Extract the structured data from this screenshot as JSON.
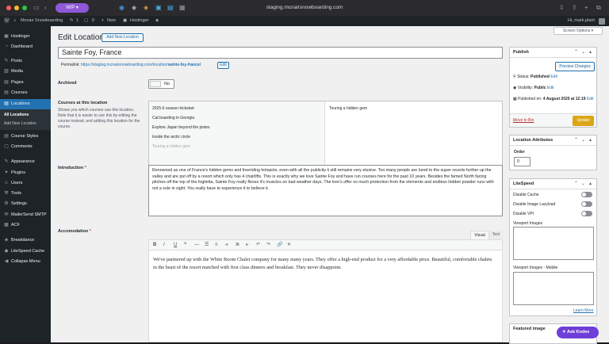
{
  "browser": {
    "wip_label": "WIP",
    "url": "staging.mcnairsnowboarding.com"
  },
  "adminbar": {
    "site": "Mcnair Snowboarding",
    "updates": "1",
    "comments": "0",
    "new": "New",
    "hostinger": "Hostinger",
    "greeting": "Hi, mark.plant"
  },
  "sidebar": {
    "items": [
      {
        "label": "Hostinger",
        "icon": "hostinger-icon"
      },
      {
        "label": "Dashboard",
        "icon": "dashboard-icon"
      },
      {
        "label": "Posts",
        "icon": "pin-icon"
      },
      {
        "label": "Media",
        "icon": "media-icon"
      },
      {
        "label": "Pages",
        "icon": "pages-icon"
      },
      {
        "label": "Courses",
        "icon": "courses-icon"
      },
      {
        "label": "Locations",
        "icon": "location-icon"
      },
      {
        "label": "Course Styles",
        "icon": "styles-icon"
      },
      {
        "label": "Comments",
        "icon": "comment-icon"
      },
      {
        "label": "Appearance",
        "icon": "brush-icon"
      },
      {
        "label": "Plugins",
        "icon": "plugin-icon"
      },
      {
        "label": "Users",
        "icon": "users-icon"
      },
      {
        "label": "Tools",
        "icon": "wrench-icon"
      },
      {
        "label": "Settings",
        "icon": "settings-icon"
      },
      {
        "label": "MailerSend SMTP",
        "icon": "mail-icon"
      },
      {
        "label": "ACF",
        "icon": "acf-icon"
      },
      {
        "label": "Breakdance",
        "icon": "breakdance-icon"
      },
      {
        "label": "LiteSpeed Cache",
        "icon": "litespeed-icon"
      },
      {
        "label": "Collapse Menu",
        "icon": "collapse-icon"
      }
    ],
    "subitems": [
      "All Locations",
      "Add New Location"
    ]
  },
  "screen_options": "Screen Options ▾",
  "page": {
    "title": "Edit Location",
    "add_new": "Add New Location",
    "post_title": "Sainte Foy, France",
    "permalink_label": "Permalink:",
    "permalink_url": "https://staging.mcnairsnowboarding.com/location/",
    "permalink_slug": "sainte-foy-france/",
    "permalink_edit": "Edit"
  },
  "fields": {
    "archived": {
      "label": "Archived",
      "toggle_text": "No"
    },
    "courses": {
      "label": "Courses at this location",
      "desc": "Shows you which courses use this location. Note that it is easier to use this by editing the course instead, and adding this location for the course.",
      "available": [
        "2025-6 season kickstart",
        "Cat boarding in Georgia",
        "Explore Japan beyond the pistes",
        "Inside the arctic circle",
        "Touring a hidden gem"
      ],
      "selected": [
        "Touring a hidden gem"
      ]
    },
    "introduction": {
      "label": "Introduction",
      "required": "*",
      "text": "Renowned as one of France's hidden gems and freeriding hotspots, even with all the publicity it still remains very elusive. Too many people are lured to the super resorts further up the valley and are put off by a resort which only has 4 chairlifts. This is exactly why we love Sainte Foy and have run courses here for the past 10 years. Besides the famed North facing pitches off the top of the foglietta, Sainte Foy really flexes it's muscles on bad weather days. The tree's offer so much protection from the elements and endless hidden powder runs with not a sole in sight. You really have to experience it to believe it."
    },
    "accomodation": {
      "label": "Accomodation",
      "required": "*",
      "tab_visual": "Visual",
      "tab_text": "Text",
      "text": "We've partnered up with the White Room Chalet company for many many years. They offer a high-end product for a very affordable price. Beautiful, comfortable chalets in the heart of the resort matched with first class dinners and breakfast. They never disappoint."
    }
  },
  "toolbar": [
    "B",
    "I",
    "U",
    "❝",
    "—",
    "☰",
    "≡",
    "⫷",
    "≣",
    "⫸",
    "↶",
    "↷",
    "🔗",
    "✕"
  ],
  "publish": {
    "title": "Publish",
    "preview": "Preview Changes",
    "status_label": "Status:",
    "status": "Published",
    "status_edit": "Edit",
    "visibility_label": "Visibility:",
    "visibility": "Public",
    "visibility_edit": "Edit",
    "published_label": "Published on:",
    "published_date": "4 August 2025 at 12:19",
    "published_edit": "Edit",
    "trash": "Move to Bin",
    "update": "Update"
  },
  "attributes": {
    "title": "Location Attributes",
    "order_label": "Order",
    "order": "0"
  },
  "litespeed": {
    "title": "LiteSpeed",
    "options": [
      "Disable Cache",
      "Disable Image Lazyload",
      "Disable VPI"
    ],
    "viewport_label": "Viewport Images",
    "viewport_mobile_label": "Viewport Images - Mobile",
    "learn_more": "Learn More"
  },
  "featured": {
    "title": "Featured image"
  },
  "ask_kodee": "Ask Kodee",
  "colors": {
    "admin": "#1d2327",
    "active": "#2271b1",
    "update": "#dba617",
    "wip": "#8e58d8"
  }
}
